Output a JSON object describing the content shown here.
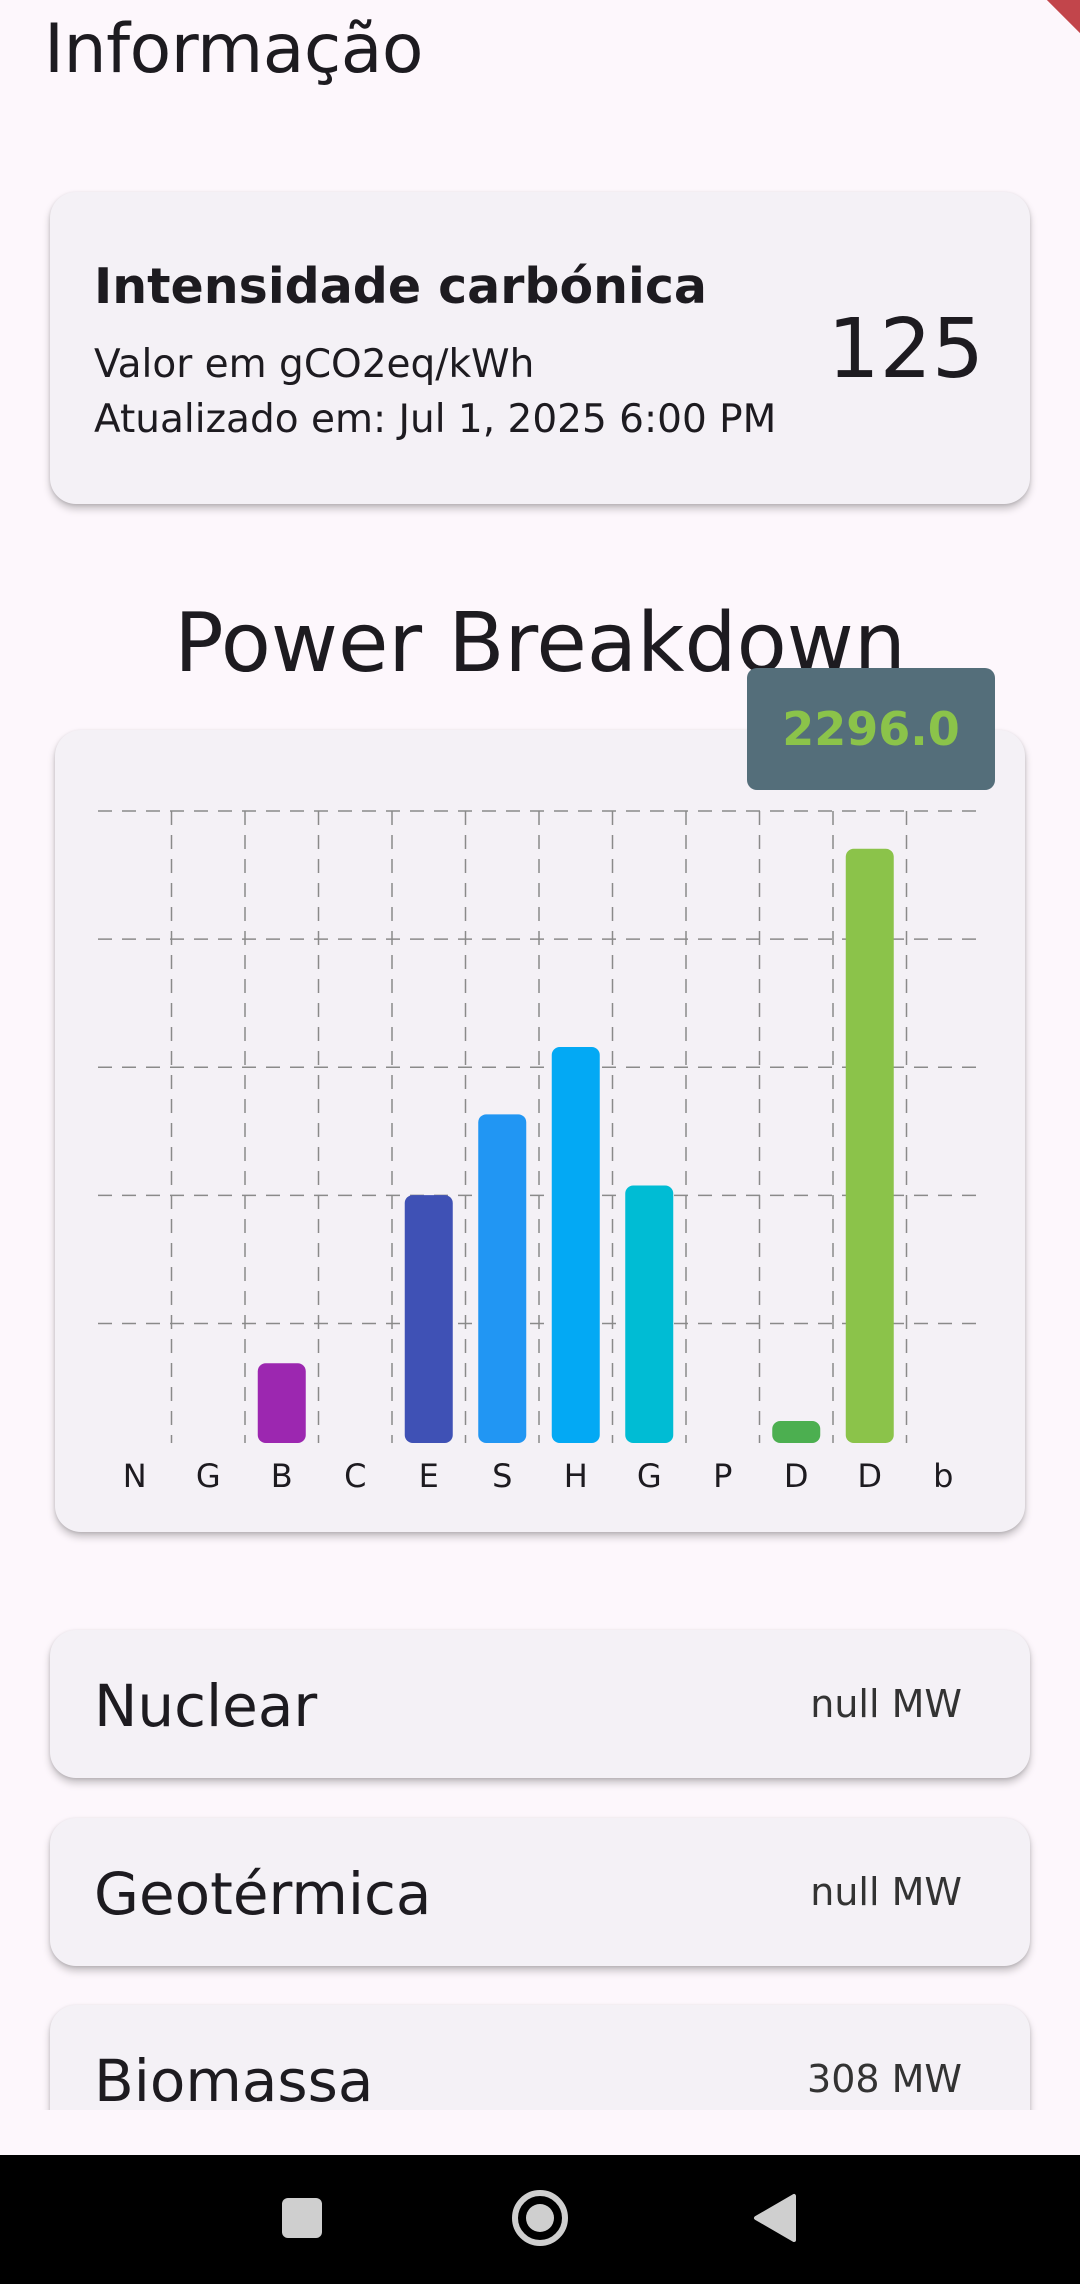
{
  "page": {
    "title": "Informação"
  },
  "carbon": {
    "title": "Intensidade carbónica",
    "unit_label": "Valor em gCO2eq/kWh",
    "updated_label": "Atualizado em: Jul 1, 2025 6:00 PM",
    "value": "125"
  },
  "breakdown": {
    "title": "Power Breakdown",
    "tooltip": "2296.0"
  },
  "colors": {
    "accent_green": "#8bc34a",
    "tooltip_bg": "#546e7a"
  },
  "chart_data": {
    "type": "bar",
    "categories": [
      "N",
      "G",
      "B",
      "C",
      "E",
      "S",
      "H",
      "G",
      "P",
      "D",
      "D",
      "b"
    ],
    "values": [
      null,
      null,
      308,
      null,
      958,
      1270,
      1530,
      995,
      null,
      80,
      2296,
      null
    ],
    "colors": [
      "#9e9e9e",
      "#9e9e9e",
      "#9c27b0",
      "#9e9e9e",
      "#3f51b5",
      "#2196f3",
      "#03a9f4",
      "#00bcd4",
      "#9e9e9e",
      "#4caf50",
      "#8bc34a",
      "#9e9e9e"
    ],
    "ylim": [
      0,
      2500
    ],
    "grid": true,
    "tooltip": {
      "category_index": 10,
      "text": "2296.0"
    }
  },
  "sources": [
    {
      "name": "Nuclear",
      "value": "null MW"
    },
    {
      "name": "Geotérmica",
      "value": "null MW"
    },
    {
      "name": "Biomassa",
      "value": "308 MW"
    }
  ],
  "navbar": {
    "icons": [
      "recents-square-icon",
      "home-circle-icon",
      "back-triangle-icon"
    ]
  }
}
